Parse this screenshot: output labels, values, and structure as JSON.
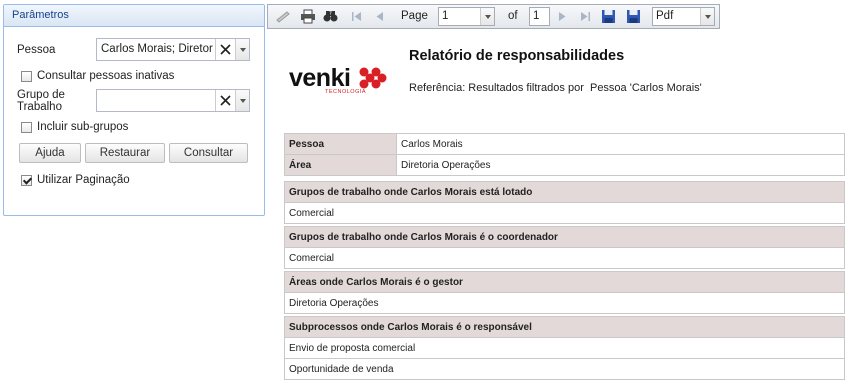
{
  "panel": {
    "title": "Parâmetros",
    "pessoa_label": "Pessoa",
    "pessoa_value": "Carlos Morais; Diretor",
    "inativas_label": "Consultar pessoas inativas",
    "inativas_checked": false,
    "grupo_label_1": "Grupo de",
    "grupo_label_2": "Trabalho",
    "grupo_value": "",
    "subgrupos_label": "Incluir sub-grupos",
    "subgrupos_checked": false,
    "buttons": {
      "ajuda": "Ajuda",
      "restaurar": "Restaurar",
      "consultar": "Consultar"
    },
    "paginacao_label": "Utilizar Paginação",
    "paginacao_checked": true
  },
  "toolbar": {
    "page_label": "Page",
    "page_value": "1",
    "of_label": "of",
    "total_pages": "1",
    "format_value": "Pdf",
    "icons": [
      "no-print-icon",
      "print-icon",
      "find-icon",
      "first-page-icon",
      "prev-page-icon",
      "next-page-icon",
      "last-page-icon",
      "save-icon",
      "export-icon"
    ]
  },
  "report": {
    "logo_text": "venki",
    "logo_sub": "TECNOLOGIA",
    "brand_color": "#d91f26",
    "title": "Relatório de responsabilidades",
    "reference": "Referência: Resultados filtrados por  Pessoa 'Carlos Morais'",
    "info": [
      {
        "key": "Pessoa",
        "value": "Carlos Morais"
      },
      {
        "key": "Área",
        "value": "Diretoria Operações"
      }
    ],
    "sections": [
      {
        "header": "Grupos de trabalho onde Carlos Morais está lotado",
        "rows": [
          "Comercial"
        ]
      },
      {
        "header": "Grupos de trabalho onde Carlos Morais é o coordenador",
        "rows": [
          "Comercial"
        ]
      },
      {
        "header": "Áreas onde Carlos Morais é o gestor",
        "rows": [
          "Diretoria Operações"
        ]
      },
      {
        "header": "Subprocessos onde Carlos Morais é o responsável",
        "rows": [
          "Envio de proposta comercial",
          "Oportunidade de venda"
        ]
      }
    ]
  }
}
